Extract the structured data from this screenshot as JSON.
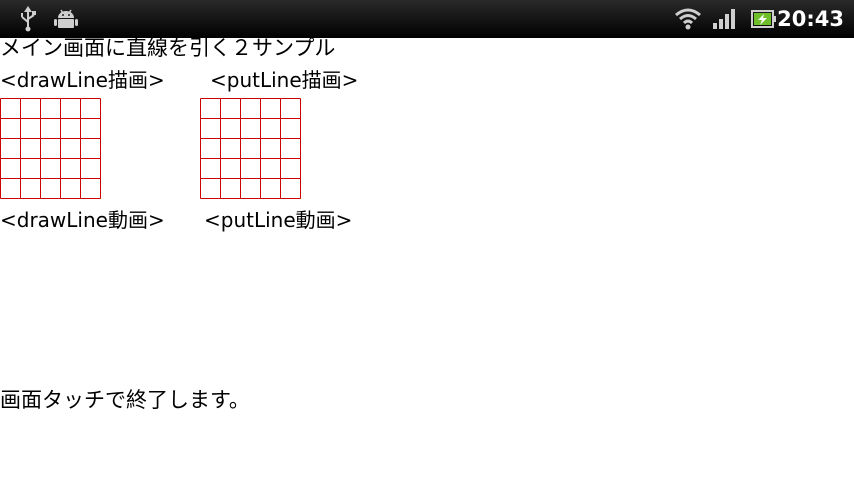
{
  "status_bar": {
    "time": "20:43",
    "icons": [
      "usb-icon",
      "android-debug-icon",
      "wifi-icon",
      "signal-icon",
      "battery-charging-icon"
    ],
    "icon_color": "#cfcfcf",
    "battery_color": "#6fbf2a"
  },
  "app": {
    "title": "メイン画面に直線を引く２サンプル",
    "label_drawline_draw": "<drawLine描画>",
    "label_putline_draw": "<putLine描画>",
    "label_drawline_anim": "<drawLine動画>",
    "label_putline_anim": "<putLine動画>",
    "footer": "画面タッチで終了します。",
    "grid_color": "#cc0000",
    "grid_cells": 5
  }
}
